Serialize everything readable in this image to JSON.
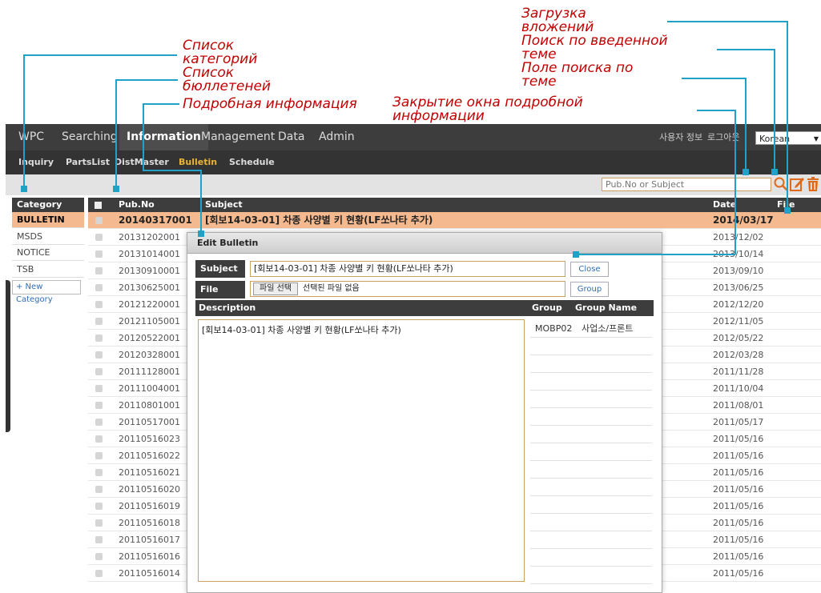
{
  "callouts": {
    "attachment_upload": "Загрузка вложений",
    "search_entered": "Поиск по введенной теме",
    "search_field": "Поле поиска по теме",
    "close_detail": "Закрытие окна подробной информации",
    "category_list": "Список категорий",
    "bulletin_list": "Список бюллетеней",
    "details": "Подробная информация"
  },
  "topnav": {
    "items": [
      "WPC",
      "Searching",
      "Information",
      "Management",
      "Data",
      "Admin"
    ],
    "active": "Information",
    "user_info": "사용자 정보",
    "logout": "로그아웃",
    "language": "Korean"
  },
  "subnav": {
    "items": [
      "Inquiry",
      "PartsList",
      "DistMaster",
      "Bulletin",
      "Schedule"
    ],
    "active": "Bulletin"
  },
  "toolbar": {
    "search_placeholder": "Pub.No or Subject",
    "search_icon": "magnifier-icon",
    "edit_icon": "edit-icon",
    "delete_icon": "trash-icon"
  },
  "categories": {
    "header": "Category",
    "items": [
      "BULLETIN",
      "MSDS",
      "NOTICE",
      "TSB"
    ],
    "new_label": "+ New Category"
  },
  "list": {
    "headers": {
      "pub": "Pub.No",
      "subject": "Subject",
      "date": "Date",
      "file": "File"
    },
    "rows": [
      {
        "pub": "20140317001",
        "subject": "[회보14-03-01] 차종 사양별 키 현황(LF쏘나타 추가)",
        "date": "2014/03/17"
      },
      {
        "pub": "20131202001",
        "date": "2013/12/02"
      },
      {
        "pub": "20131014001",
        "date": "2013/10/14"
      },
      {
        "pub": "20130910001",
        "date": "2013/09/10"
      },
      {
        "pub": "20130625001",
        "date": "2013/06/25"
      },
      {
        "pub": "20121220001",
        "date": "2012/12/20"
      },
      {
        "pub": "20121105001",
        "date": "2012/11/05"
      },
      {
        "pub": "20120522001",
        "date": "2012/05/22"
      },
      {
        "pub": "20120328001",
        "date": "2012/03/28"
      },
      {
        "pub": "20111128001",
        "date": "2011/11/28"
      },
      {
        "pub": "20111004001",
        "date": "2011/10/04"
      },
      {
        "pub": "20110801001",
        "date": "2011/08/01"
      },
      {
        "pub": "20110517001",
        "date": "2011/05/17"
      },
      {
        "pub": "20110516023",
        "date": "2011/05/16"
      },
      {
        "pub": "20110516022",
        "date": "2011/05/16"
      },
      {
        "pub": "20110516021",
        "date": "2011/05/16"
      },
      {
        "pub": "20110516020",
        "date": "2011/05/16"
      },
      {
        "pub": "20110516019",
        "date": "2011/05/16"
      },
      {
        "pub": "20110516018",
        "date": "2011/05/16"
      },
      {
        "pub": "20110516017",
        "date": "2011/05/16"
      },
      {
        "pub": "20110516016",
        "date": "2011/05/16"
      },
      {
        "pub": "20110516014",
        "date": "2011/05/16"
      }
    ]
  },
  "dialog": {
    "title": "Edit Bulletin",
    "subject_label": "Subject",
    "subject_value": "[회보14-03-01] 차종 사양별 키 현황(LF쏘나타 추가)",
    "close_label": "Close",
    "file_label": "File",
    "file_choose": "파일 선택",
    "file_status": "선택된 파일 없음",
    "group_button": "Group",
    "desc_header": "Description",
    "group_header": "Group",
    "group_name_header": "Group Name",
    "description": "[회보14-03-01] 차종 사양별 키 현황(LF쏘나타 추가)",
    "groups": [
      {
        "code": "MOBP02",
        "name": "사업소/프론트"
      }
    ]
  },
  "colors": {
    "nav_bg": "#3d3d3d",
    "highlight": "#f4b98e",
    "accent": "#e8b43a",
    "callout_text": "#c00000",
    "callout_line": "#1fa1c8",
    "icon_orange": "#e06a1b"
  }
}
